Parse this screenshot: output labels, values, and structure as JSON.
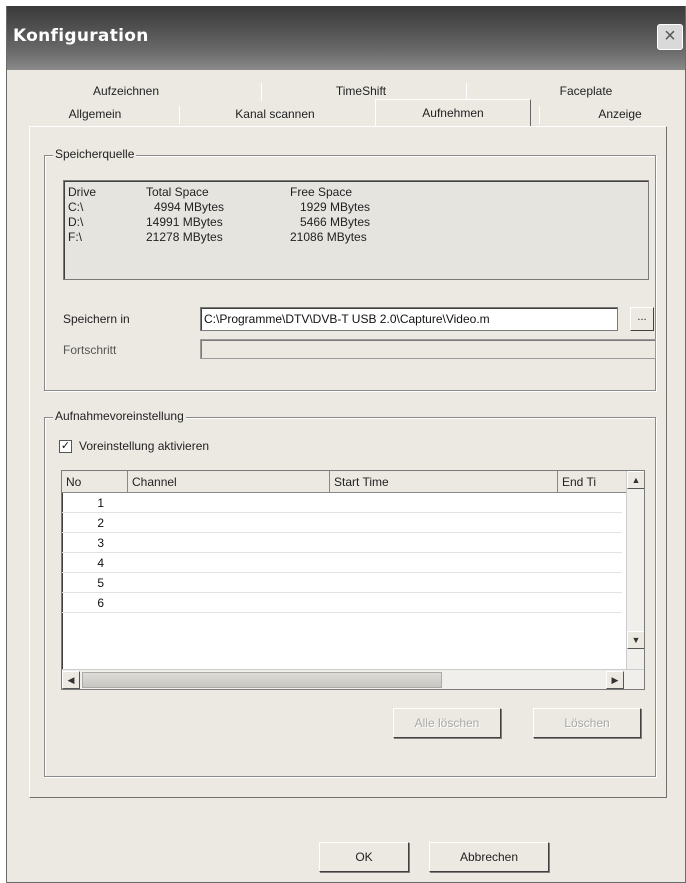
{
  "window": {
    "title": "Konfiguration",
    "close_glyph": "×"
  },
  "tabs": {
    "back": [
      "Aufzeichnen",
      "TimeShift",
      "Faceplate"
    ],
    "front": [
      "Allgemein",
      "Kanal scannen",
      "Aufnehmen",
      "Anzeige"
    ],
    "active": "Aufnehmen"
  },
  "storage": {
    "legend": "Speicherquelle",
    "headers": {
      "drive": "Drive",
      "total": "Total Space",
      "free": "Free Space"
    },
    "drives": [
      {
        "drive": "C:\\",
        "total": "4994 MBytes",
        "free": "1929 MBytes"
      },
      {
        "drive": "D:\\",
        "total": "14991 MBytes",
        "free": "5466 MBytes"
      },
      {
        "drive": "F:\\",
        "total": "21278 MBytes",
        "free": "21086 MBytes"
      }
    ],
    "save_in_label": "Speichern in",
    "save_path": "C:\\Programme\\DTV\\DVB-T USB 2.0\\Capture\\Video.m",
    "browse_label": "...",
    "progress_label": "Fortschritt",
    "progress_value": 0
  },
  "preset": {
    "legend": "Aufnahmevoreinstellung",
    "checkbox_label": "Voreinstellung aktivieren",
    "checkbox_checked": true,
    "columns": [
      "No",
      "Channel",
      "Start Time",
      "End Ti"
    ],
    "rows": [
      "1",
      "2",
      "3",
      "4",
      "5",
      "6"
    ],
    "delete_all_label": "Alle löschen",
    "delete_label": "Löschen"
  },
  "footer": {
    "ok_label": "OK",
    "cancel_label": "Abbrechen"
  },
  "icons": {
    "check": "✓",
    "scroll_up": "▲",
    "scroll_down": "▼",
    "scroll_left": "◀",
    "scroll_right": "▶"
  }
}
